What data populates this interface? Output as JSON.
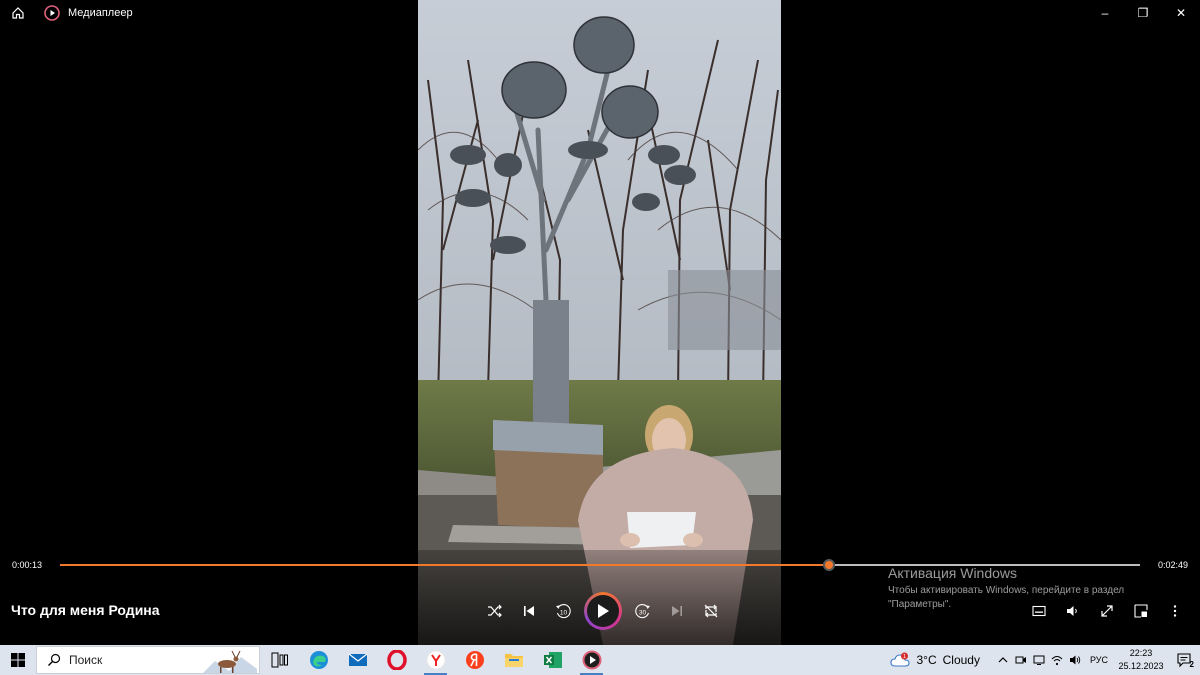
{
  "window": {
    "title": "Медиаплеер",
    "minimize_glyph": "–",
    "restore_glyph": "❐",
    "close_glyph": "✕"
  },
  "player": {
    "media_title": "Что для меня Родина",
    "current_time": "0:00:13",
    "total_time": "0:02:49",
    "progress": 0.712,
    "skip_back_seconds": "10",
    "skip_forward_seconds": "30",
    "accent_color": "#f2782b"
  },
  "activation": {
    "title": "Активация Windows",
    "line1": "Чтобы активировать Windows, перейдите в раздел",
    "line2": "\"Параметры\"."
  },
  "taskbar": {
    "search_placeholder": "Поиск",
    "weather_temp": "3°C",
    "weather_desc": "Cloudy",
    "weather_badge": "1",
    "language": "РУС",
    "time": "22:23",
    "date": "25.12.2023",
    "notification_count": "2",
    "apps": [
      "task-view",
      "edge",
      "mail",
      "opera",
      "yandex-browser",
      "yandex",
      "file-explorer",
      "excel",
      "media-player"
    ]
  }
}
